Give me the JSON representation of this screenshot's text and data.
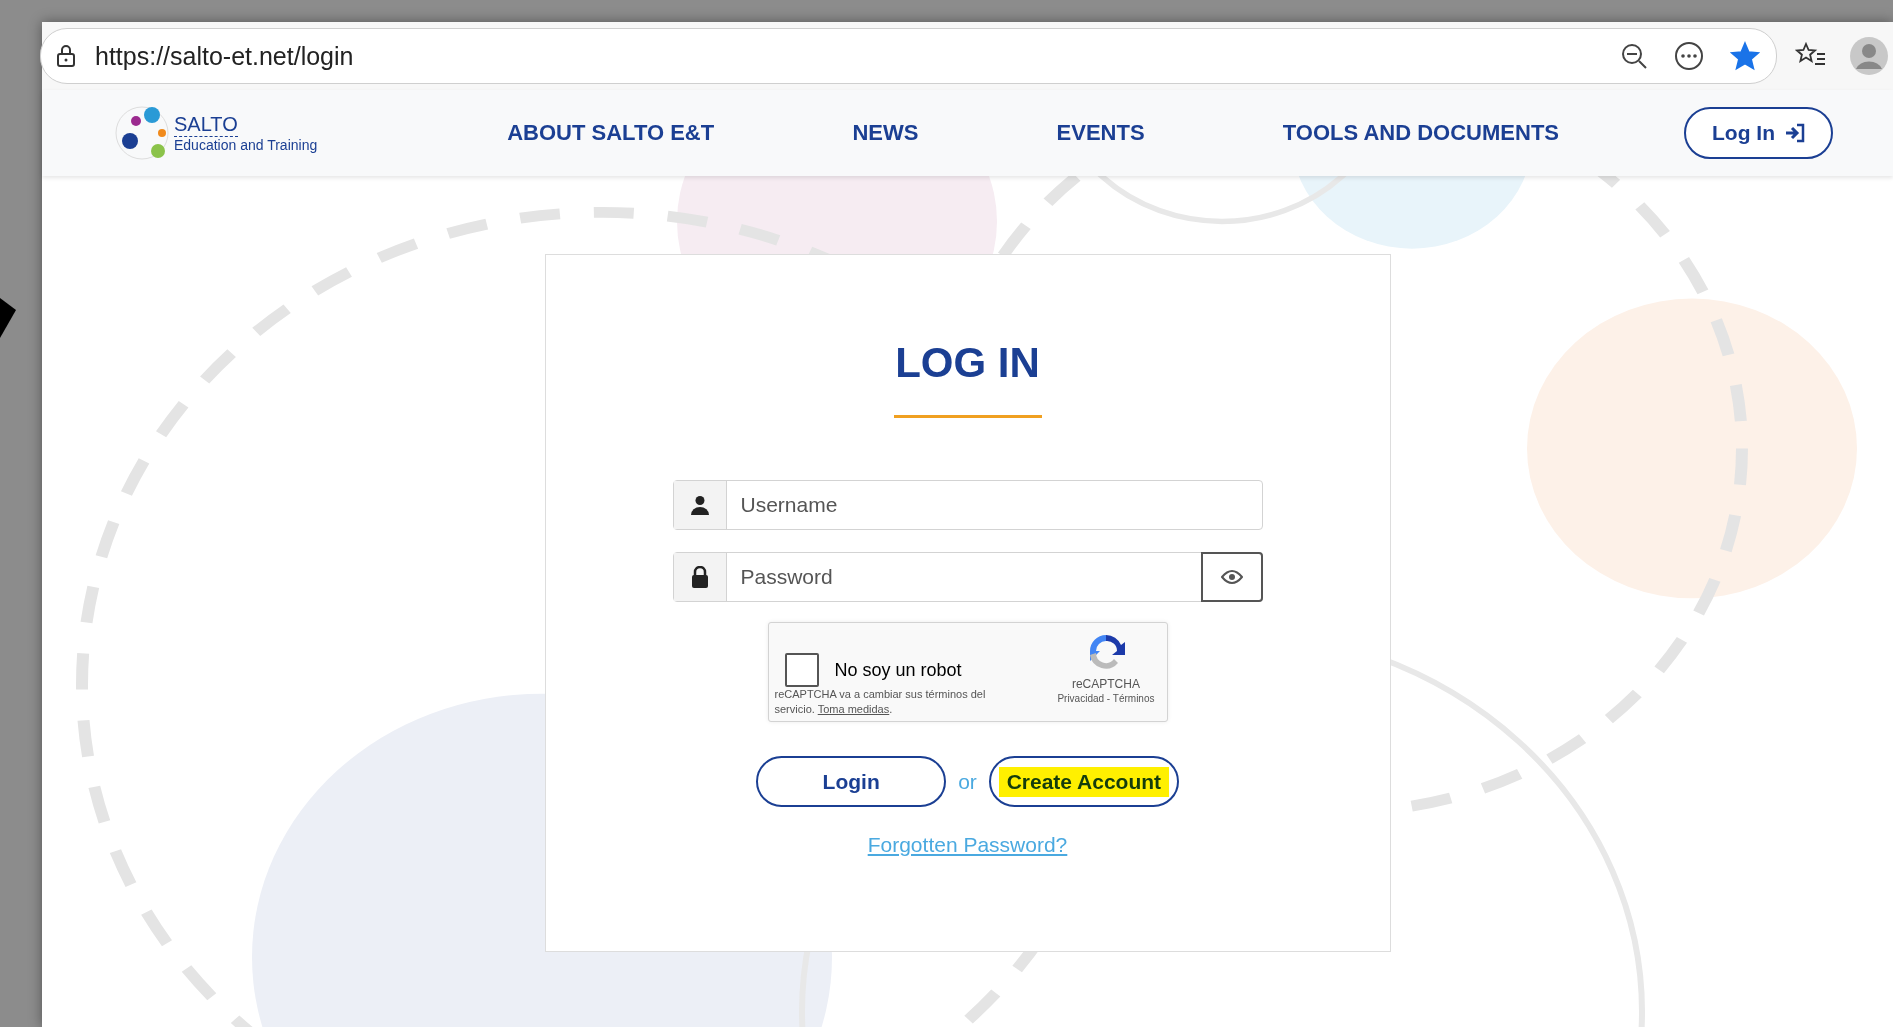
{
  "browser": {
    "url": "https://salto-et.net/login",
    "favorite": true
  },
  "nav": {
    "logo": {
      "name": "SALTO",
      "tagline": "Education and Training"
    },
    "links": [
      "ABOUT SALTO E&T",
      "NEWS",
      "EVENTS",
      "TOOLS AND DOCUMENTS"
    ],
    "login_button": "Log In"
  },
  "login_form": {
    "title": "LOG IN",
    "username": {
      "placeholder": "Username"
    },
    "password": {
      "placeholder": "Password"
    },
    "captcha": {
      "checked": false,
      "label": "No soy un robot",
      "notice": "reCAPTCHA va a cambiar sus términos del servicio.",
      "notice_link": "Toma medidas",
      "notice_end": ".",
      "brand": "reCAPTCHA",
      "privacy": "Privacidad",
      "separator": "-",
      "terms": "Términos"
    },
    "login_button": "Login",
    "or": "or",
    "create_account": {
      "label": "Create Account",
      "highlighted": true
    },
    "forgot_link": "Forgotten Password?"
  }
}
